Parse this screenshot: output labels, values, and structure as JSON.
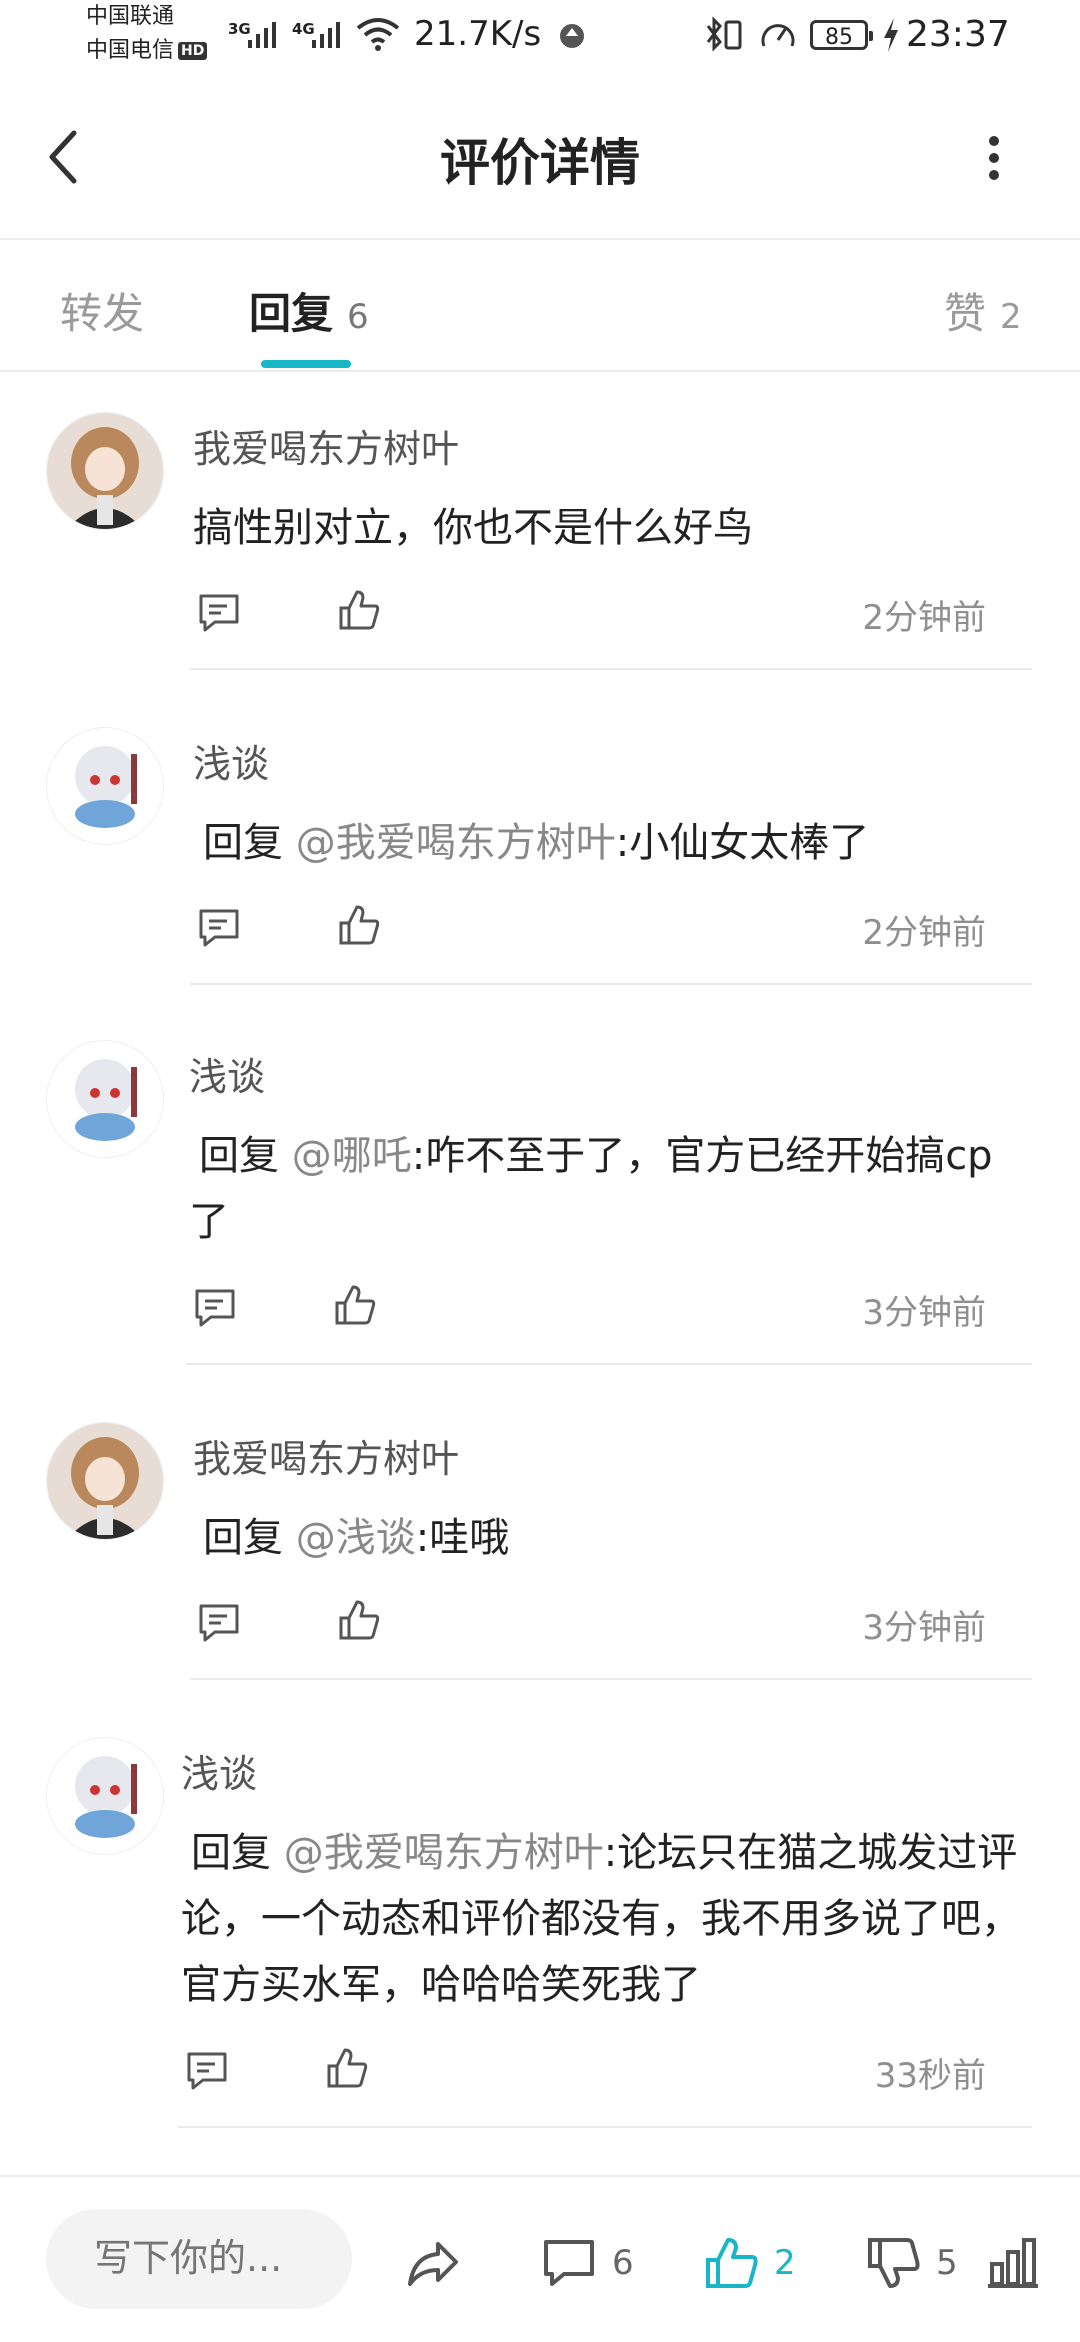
{
  "status_bar": {
    "carrier_1": "中国联通",
    "carrier_2": "中国电信",
    "hd_badge": "HD",
    "network_1": "3G",
    "network_2": "4G",
    "net_speed": "21.7K/s",
    "battery_level": "85",
    "time": "23:37"
  },
  "header": {
    "title": "评价详情",
    "back_icon": "chevron-left-icon",
    "more_icon": "more-vertical-icon"
  },
  "tabs": [
    {
      "label": "转发",
      "count": ""
    },
    {
      "label": "回复",
      "count": "6"
    },
    {
      "label": "赞",
      "count": "2"
    }
  ],
  "comments": [
    {
      "username": "我爱喝东方树叶",
      "reply_prefix": "",
      "mention": "",
      "text": "搞性别对立，你也不是什么好鸟",
      "time": "2分钟前"
    },
    {
      "username": "浅谈",
      "reply_prefix": "回复 ",
      "mention": "@我爱喝东方树叶",
      "text": ":小仙女太棒了",
      "time": "2分钟前"
    },
    {
      "username": "浅谈",
      "reply_prefix": "回复 ",
      "mention": "@哪吒",
      "text": ":咋不至于了，官方已经开始搞cp了",
      "time": "3分钟前"
    },
    {
      "username": "我爱喝东方树叶",
      "reply_prefix": "回复 ",
      "mention": "@浅谈",
      "text": ":哇哦",
      "time": "3分钟前"
    },
    {
      "username": "浅谈",
      "reply_prefix": "回复 ",
      "mention": "@我爱喝东方树叶",
      "text": ":论坛只在猫之城发过评论，一个动态和评价都没有，我不用多说了吧，官方买水军，哈哈哈笑死我了",
      "time": "33秒前"
    }
  ],
  "bottom_bar": {
    "compose_placeholder": "写下你的...",
    "comment_count": "6",
    "like_count": "2",
    "dislike_count": "5"
  },
  "colors": {
    "accent": "#18b6c6",
    "text": "#222222",
    "muted": "#8f8f8f"
  }
}
